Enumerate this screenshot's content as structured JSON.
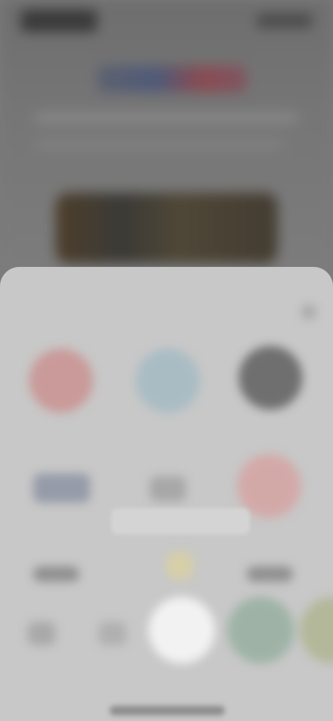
{
  "share_sheet": {
    "title": "",
    "top_apps": [
      {
        "icon": "app-icon-red",
        "label": "",
        "color": "#c99a99"
      },
      {
        "icon": "app-icon-blue",
        "label": "",
        "color": "#a9bcc4"
      },
      {
        "icon": "app-icon-dark",
        "label": "",
        "color": "#6f6f6f"
      }
    ],
    "second_row": [
      {
        "icon": "app-icon-slate",
        "label": "",
        "color": "#959ba8"
      },
      {
        "icon": "app-icon-grey",
        "label": "",
        "color": "#a7a7a7"
      },
      {
        "icon": "app-icon-pink",
        "label": "",
        "color": "#d3a9a8"
      }
    ],
    "toast_text": "",
    "bottom_row": [
      {
        "icon": "action-icon-1",
        "label": "",
        "color": "#a9a9a9"
      },
      {
        "icon": "action-icon-2",
        "label": "",
        "color": "#b0b0b0"
      },
      {
        "icon": "action-icon-3",
        "label": "",
        "color": "#f2f2f2"
      },
      {
        "icon": "action-icon-4",
        "label": "",
        "color": "#9eb3a6"
      },
      {
        "icon": "action-icon-5",
        "label": "",
        "color": "#b3b89a"
      }
    ]
  }
}
